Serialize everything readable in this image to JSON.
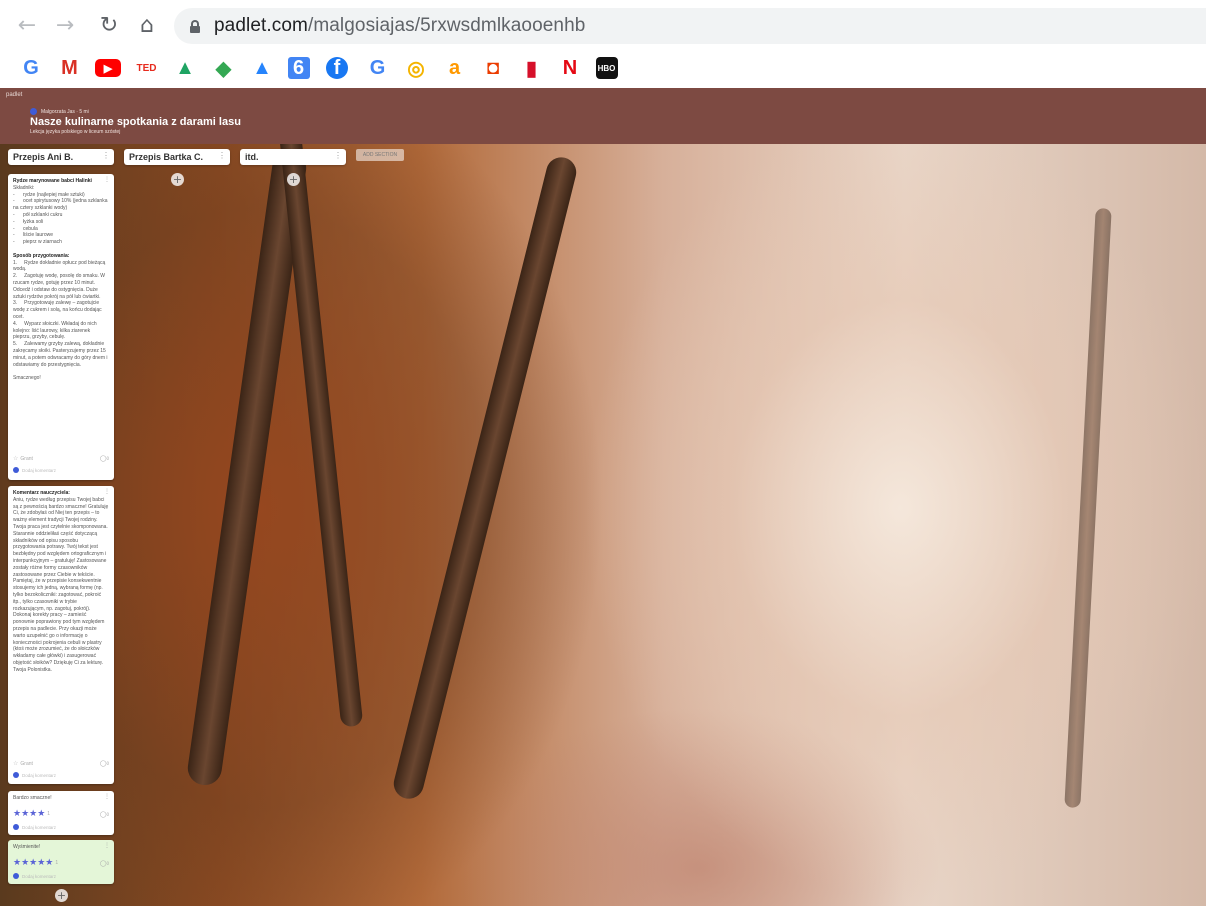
{
  "browser": {
    "url_domain": "padlet.com",
    "url_path": "/malgosiajas/5rxwsdmlkaooenhb",
    "bookmarks": [
      {
        "icon": "google-icon",
        "glyph": "G",
        "color": "#4285f4"
      },
      {
        "icon": "gmail-icon",
        "glyph": "M",
        "color": "#d93025"
      },
      {
        "icon": "youtube-icon",
        "glyph": "▶",
        "color": "#ff0000"
      },
      {
        "icon": "ted-icon",
        "glyph": "TED",
        "color": "#e62b1e"
      },
      {
        "icon": "drive-icon",
        "glyph": "▲",
        "color": "#1fa463"
      },
      {
        "icon": "maps-icon",
        "glyph": "◆",
        "color": "#34a853"
      },
      {
        "icon": "drive-icon-2",
        "glyph": "▲",
        "color": "#2684fc"
      },
      {
        "icon": "calendar-icon",
        "glyph": "6",
        "color": "#4285f4"
      },
      {
        "icon": "facebook-icon",
        "glyph": "f",
        "color": "#1877f2"
      },
      {
        "icon": "google-icon-2",
        "glyph": "G",
        "color": "#4285f4"
      },
      {
        "icon": "target-icon",
        "glyph": "◎",
        "color": "#f4b400"
      },
      {
        "icon": "amazon-icon",
        "glyph": "a",
        "color": "#ff9900"
      },
      {
        "icon": "office-icon",
        "glyph": "◘",
        "color": "#eb3c00"
      },
      {
        "icon": "red-bookmark-icon",
        "glyph": "▮",
        "color": "#d6102a"
      },
      {
        "icon": "netflix-icon",
        "glyph": "N",
        "color": "#e50914"
      },
      {
        "icon": "hbogo-icon",
        "glyph": "HBO",
        "color": "#111111"
      }
    ]
  },
  "padlet": {
    "corner_label": "padlet",
    "author": "Malgorzata Jas  ·  5 mi",
    "title": "Nasze kulinarne spotkania z darami lasu",
    "subtitle": "Lekcja języka polskiego w liceum szóstej",
    "add_section_label": "ADD SECTION",
    "sections": [
      {
        "title": "Przepis Ani B."
      },
      {
        "title": "Przepis Bartka C."
      },
      {
        "title": "itd."
      }
    ],
    "posts": {
      "recipe": {
        "title": "Rydze marynowane babci Halinki",
        "body": "Składniki:\n-      rydze (najlepiej małe sztuki)\n-      ocet spirytusowy 10% (jedna szklanka na cztery szklanki wody)\n-      pół szklanki cukru\n-      łyżka soli\n-      cebula\n-      liście laurowe\n-      pieprz w ziarnach",
        "method_title": "Sposób przygotowania:",
        "method": "1.     Rydze dokładnie opłucz pod bieżącą wodą.\n2.     Zagotuję wodę, posolę do smaku. W rzucam rydze, gotuję przez 10 minut. Odcedź i odstaw do ostygnięcia. Duże sztuki rydzów pokrój na pół lub ćwiartki.\n3.     Przygotowuję zalewę – zagotujcie wodę z cukrem i solą, na końcu dodając ocet.\n4.     Wyparz słoiczki. Wkładaj do nich kolejno: liść laurowy, kilka ziarenek pieprzu, grzyby, cebulę.\n5.     Zalewamy grzyby zalewą, dokładnie zakręcamy słoiki. Pasteryzujemy przez 15 minut, a potem odwracamy do góry dnem i odstawiamy do przestygnięcia.\n\nSmacznego!",
        "rating_label": "Grant",
        "comment_count": "0",
        "comment_placeholder": "Dodaj komentarz"
      },
      "teacher": {
        "title": "Komentarz nauczyciela:",
        "body": "Aniu, rydze według przepisu Twojej babci są z pewnością bardzo smaczne! Gratuluję Ci, że zdobyłaś od Niej ten przepis – to ważny element tradycji Twojej rodziny. Twoja praca jest czytelnie skomponowana. Starannie oddzieliłaś część dotyczącą składników od opisu sposobu przygotowania potrawy. Twój tekst jest bezbłędny pod względem ortograficznym i interpunkcyjnym – gratuluję! Zastosowane zostały różne formy czasowników zastosowane przez Ciebie w tekście. Pamiętaj, że w przepisie konsekwentnie stosujemy ich jedną, wybraną formę (np. tylko bezokoliczniki: zagotować, pokroić itp., tylko czasowniki w trybie rozkazującym, np. zagotuj, pokrój). Dokonaj korekty pracy – zamieść ponownie poprawiony pod tym względem przepis na padlecie. Przy okazji może warto uzupełnić go o informację o konieczności pokrojenia cebuli w plastry (ktoś może zrozumieć, że do słoiczków wkładamy całe główki) i zasugerować objętość słoików? Dziękuję Ci za lekturę. Twoja Polonistka.",
        "rating_label": "Grant",
        "comment_count": "0",
        "comment_placeholder": "Dodaj komentarz"
      },
      "comment1": {
        "title": "Bardzo smaczne!",
        "stars": "★★★★",
        "star_count": "1",
        "comment_count": "0",
        "comment_placeholder": "Dodaj komentarz"
      },
      "comment2": {
        "title": "Wyśmienite!",
        "stars": "★★★★★",
        "star_count": "1",
        "comment_count": "0",
        "comment_placeholder": "Dodaj komentarz"
      }
    }
  }
}
